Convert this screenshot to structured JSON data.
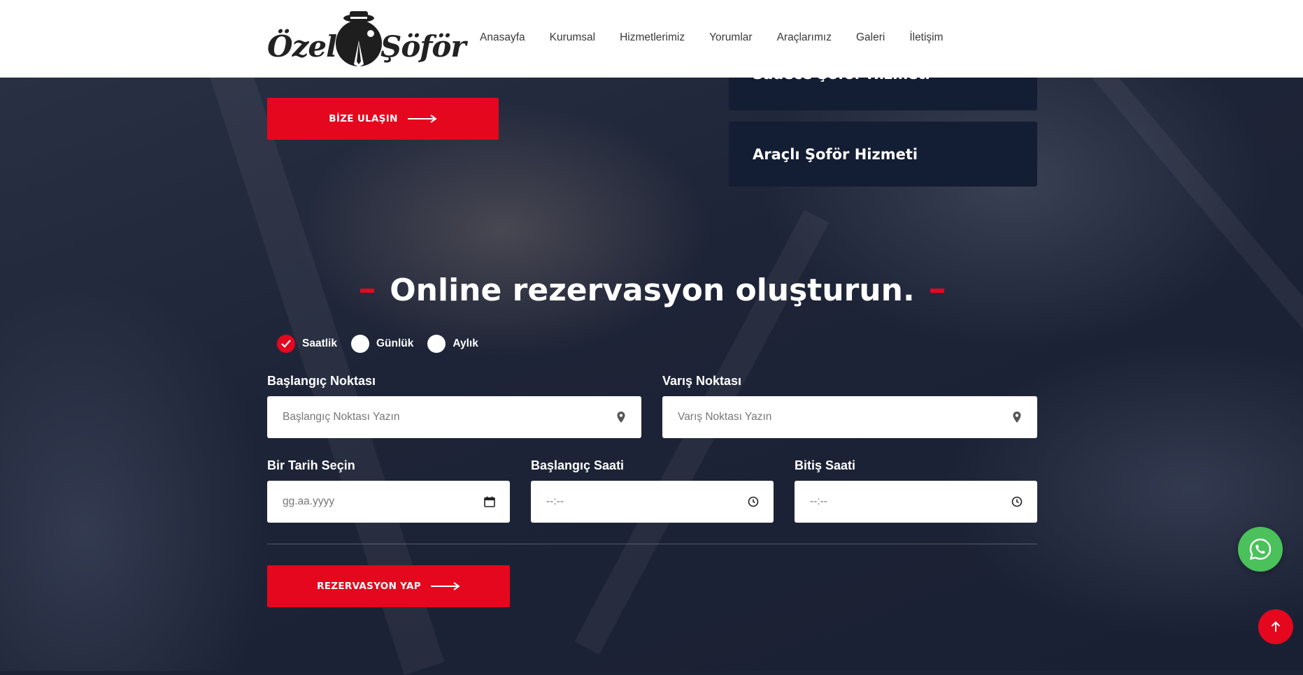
{
  "header": {
    "logo_word1": "Özel",
    "logo_word2": "Şöför",
    "nav": [
      "Anasayfa",
      "Kurumsal",
      "Hizmetlerimiz",
      "Yorumlar",
      "Araçlarımız",
      "Galeri",
      "İletişim"
    ]
  },
  "hero": {
    "contact_button": "BİZE ULAŞIN",
    "services": [
      "Sadece Şoför Hizmeti",
      "Araçlı Şoför Hizmeti"
    ]
  },
  "reservation": {
    "title": "Online rezervasyon oluşturun.",
    "types": [
      {
        "label": "Saatlik",
        "checked": true
      },
      {
        "label": "Günlük",
        "checked": false
      },
      {
        "label": "Aylık",
        "checked": false
      }
    ],
    "start_label": "Başlangıç Noktası",
    "start_placeholder": "Başlangıç Noktası Yazın",
    "end_label": "Varış Noktası",
    "end_placeholder": "Varış Noktası Yazın",
    "date_label": "Bir Tarih Seçin",
    "date_placeholder": "gg.aa.yyyy",
    "start_time_label": "Başlangıç Saati",
    "start_time_placeholder": "--:--",
    "end_time_label": "Bitiş Saati",
    "end_time_placeholder": "--:--",
    "submit_button": "REZERVASYON YAP"
  },
  "colors": {
    "accent": "#e5071e",
    "card": "#131d33",
    "whatsapp": "#4ac15a"
  }
}
